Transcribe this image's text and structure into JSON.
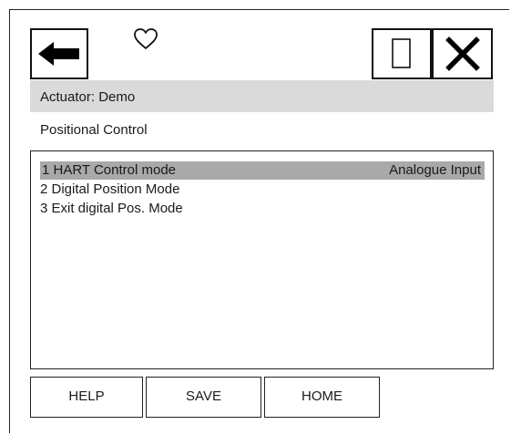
{
  "toolbar": {
    "back_icon": "arrow-left-icon",
    "favorite_icon": "heart-outline-icon",
    "window_icon": "blank-square-icon",
    "close_icon": "x-close-icon"
  },
  "header": {
    "title": "Actuator: Demo",
    "subtitle": "Positional Control"
  },
  "menu": {
    "items": [
      {
        "label": "1 HART Control mode",
        "value": "Analogue Input",
        "selected": true
      },
      {
        "label": "2 Digital Position Mode",
        "value": "",
        "selected": false
      },
      {
        "label": "3 Exit digital Pos. Mode",
        "value": "",
        "selected": false
      }
    ]
  },
  "footer": {
    "help_label": "HELP",
    "save_label": "SAVE",
    "home_label": "HOME"
  },
  "colors": {
    "title_bar": "#dadada",
    "selected_row": "#a9a9a9",
    "border": "#222222"
  }
}
